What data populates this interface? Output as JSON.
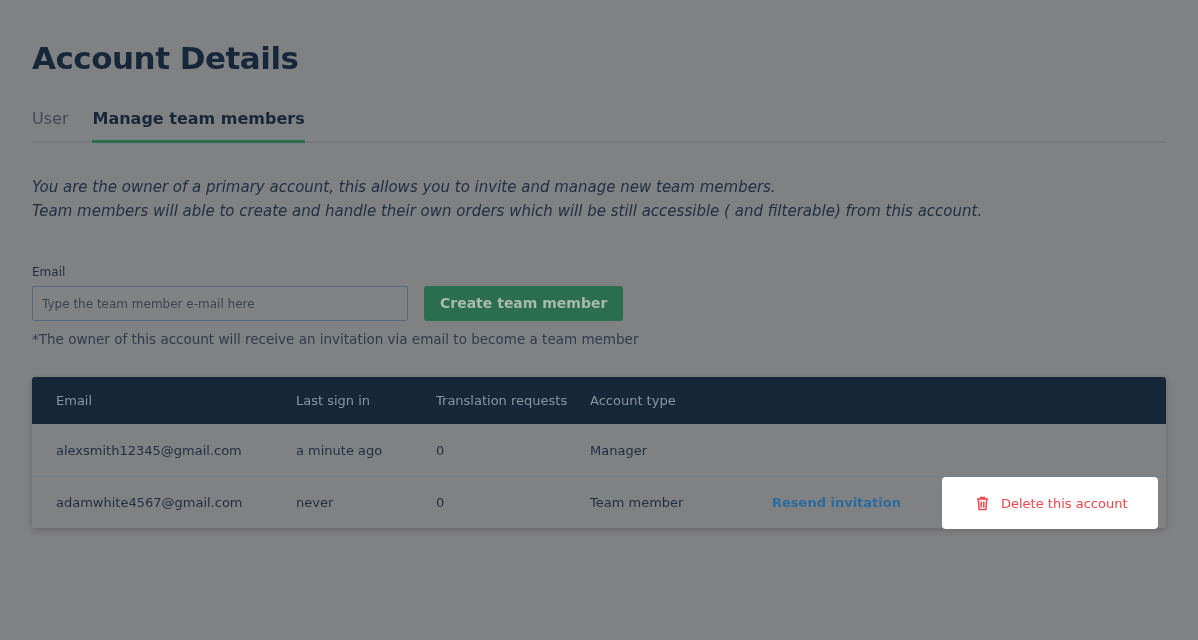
{
  "title": "Account Details",
  "tabs": [
    {
      "label": "User",
      "selected": false
    },
    {
      "label": "Manage team members",
      "selected": true
    }
  ],
  "intro": [
    "You are the owner of a primary account, this allows you to invite and manage new team members.",
    "Team members will able to create and handle their own orders which will be still accessible ( and filterable) from this account."
  ],
  "email_form": {
    "label": "Email",
    "placeholder": "Type the team member e-mail here",
    "button": "Create team member",
    "note": "*The owner of this account will receive an invitation via email to become a team member"
  },
  "table": {
    "columns": [
      "Email",
      "Last sign in",
      "Translation requests",
      "Account type"
    ],
    "rows": [
      {
        "cells": [
          "alexsmith12345@gmail.com",
          "a minute ago",
          "0",
          "Manager"
        ],
        "actions": []
      },
      {
        "cells": [
          "adamwhite4567@gmail.com",
          "never",
          "0",
          "Team member"
        ],
        "actions": [
          {
            "kind": "link",
            "label": "Resend invitation"
          },
          {
            "kind": "delete",
            "label": "Delete this account"
          }
        ]
      }
    ]
  }
}
